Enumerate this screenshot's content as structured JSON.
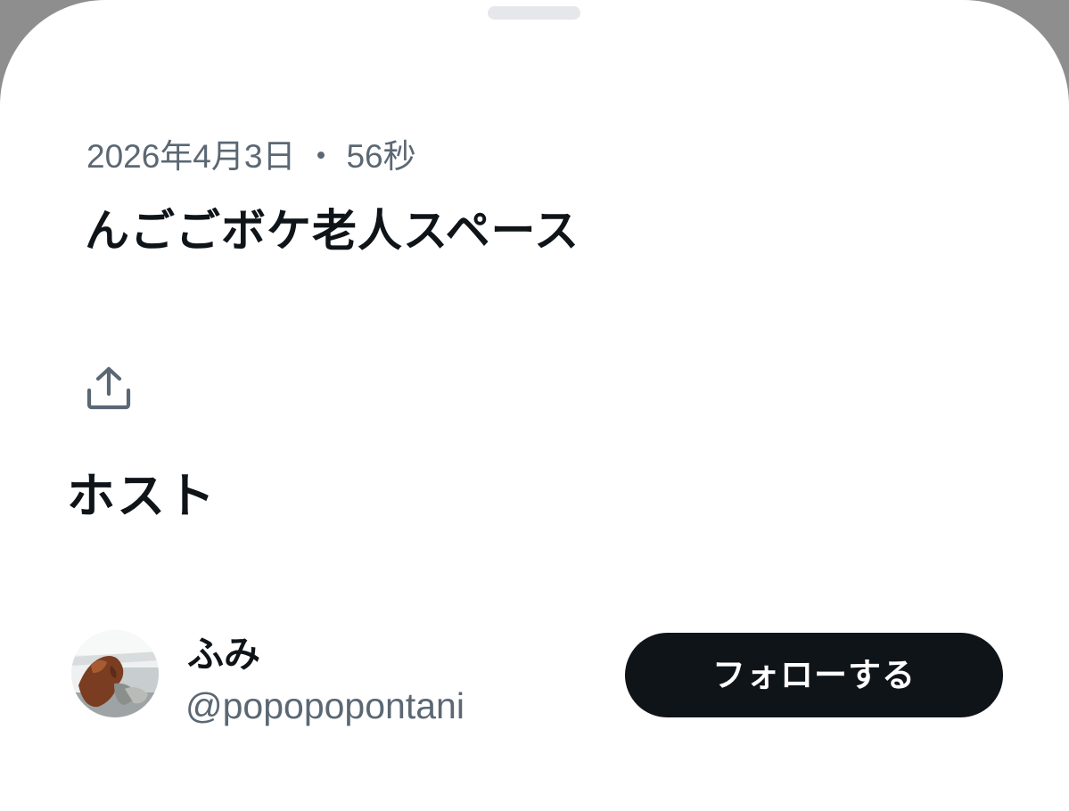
{
  "space": {
    "date": "2026年4月3日",
    "separator": "・",
    "duration": "56秒",
    "title": "んごごボケ老人スペース"
  },
  "share": {
    "icon": "share-upload-icon"
  },
  "host_section": {
    "heading": "ホスト",
    "host": {
      "name": "ふみ",
      "handle": "@popopopontani",
      "avatar_icon": "user-avatar",
      "follow_label": "フォローする"
    }
  },
  "colors": {
    "text_primary": "#0f1419",
    "text_secondary": "#5b6874",
    "button_bg": "#0f1419",
    "button_text": "#ffffff",
    "background": "#ffffff"
  }
}
